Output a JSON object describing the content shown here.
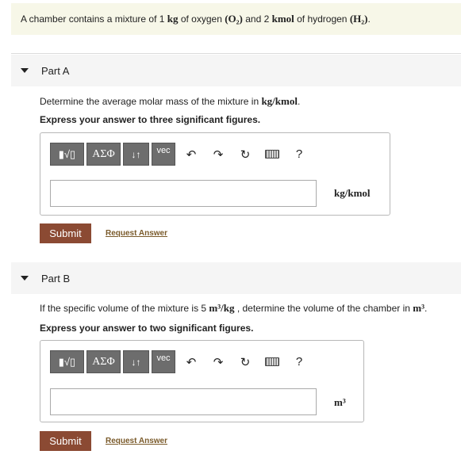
{
  "problem": {
    "t1": "A chamber contains a mixture of 1 ",
    "u1": "kg",
    "t2": " of oxygen ",
    "f1": "(O₂)",
    "t3": " and 2 ",
    "u2": "kmol",
    "t4": " of hydrogen ",
    "f2": "(H₂)",
    "t5": "."
  },
  "toolbar": {
    "templates": "▮√▯",
    "greek": "ΑΣΦ",
    "arrows": "↓↑",
    "vec": "vec",
    "undo": "↶",
    "redo": "↷",
    "reset": "↻",
    "help": "?"
  },
  "partA": {
    "title": "Part A",
    "q_text": "Determine the average molar mass of the mixture in ",
    "q_unit": "kg/kmol",
    "q_end": ".",
    "instruction": "Express your answer to three significant figures.",
    "answer_value": "",
    "unit": "kg/kmol",
    "submit": "Submit",
    "request": "Request Answer"
  },
  "partB": {
    "title": "Part B",
    "q_text1": "If the specific volume of the mixture is 5 ",
    "q_val": "m³/kg",
    "q_text2": " , determine the volume of the chamber in ",
    "q_unit": "m³",
    "q_end": ".",
    "instruction": "Express your answer to two significant figures.",
    "answer_value": "",
    "unit": "m³",
    "submit": "Submit",
    "request": "Request Answer"
  }
}
